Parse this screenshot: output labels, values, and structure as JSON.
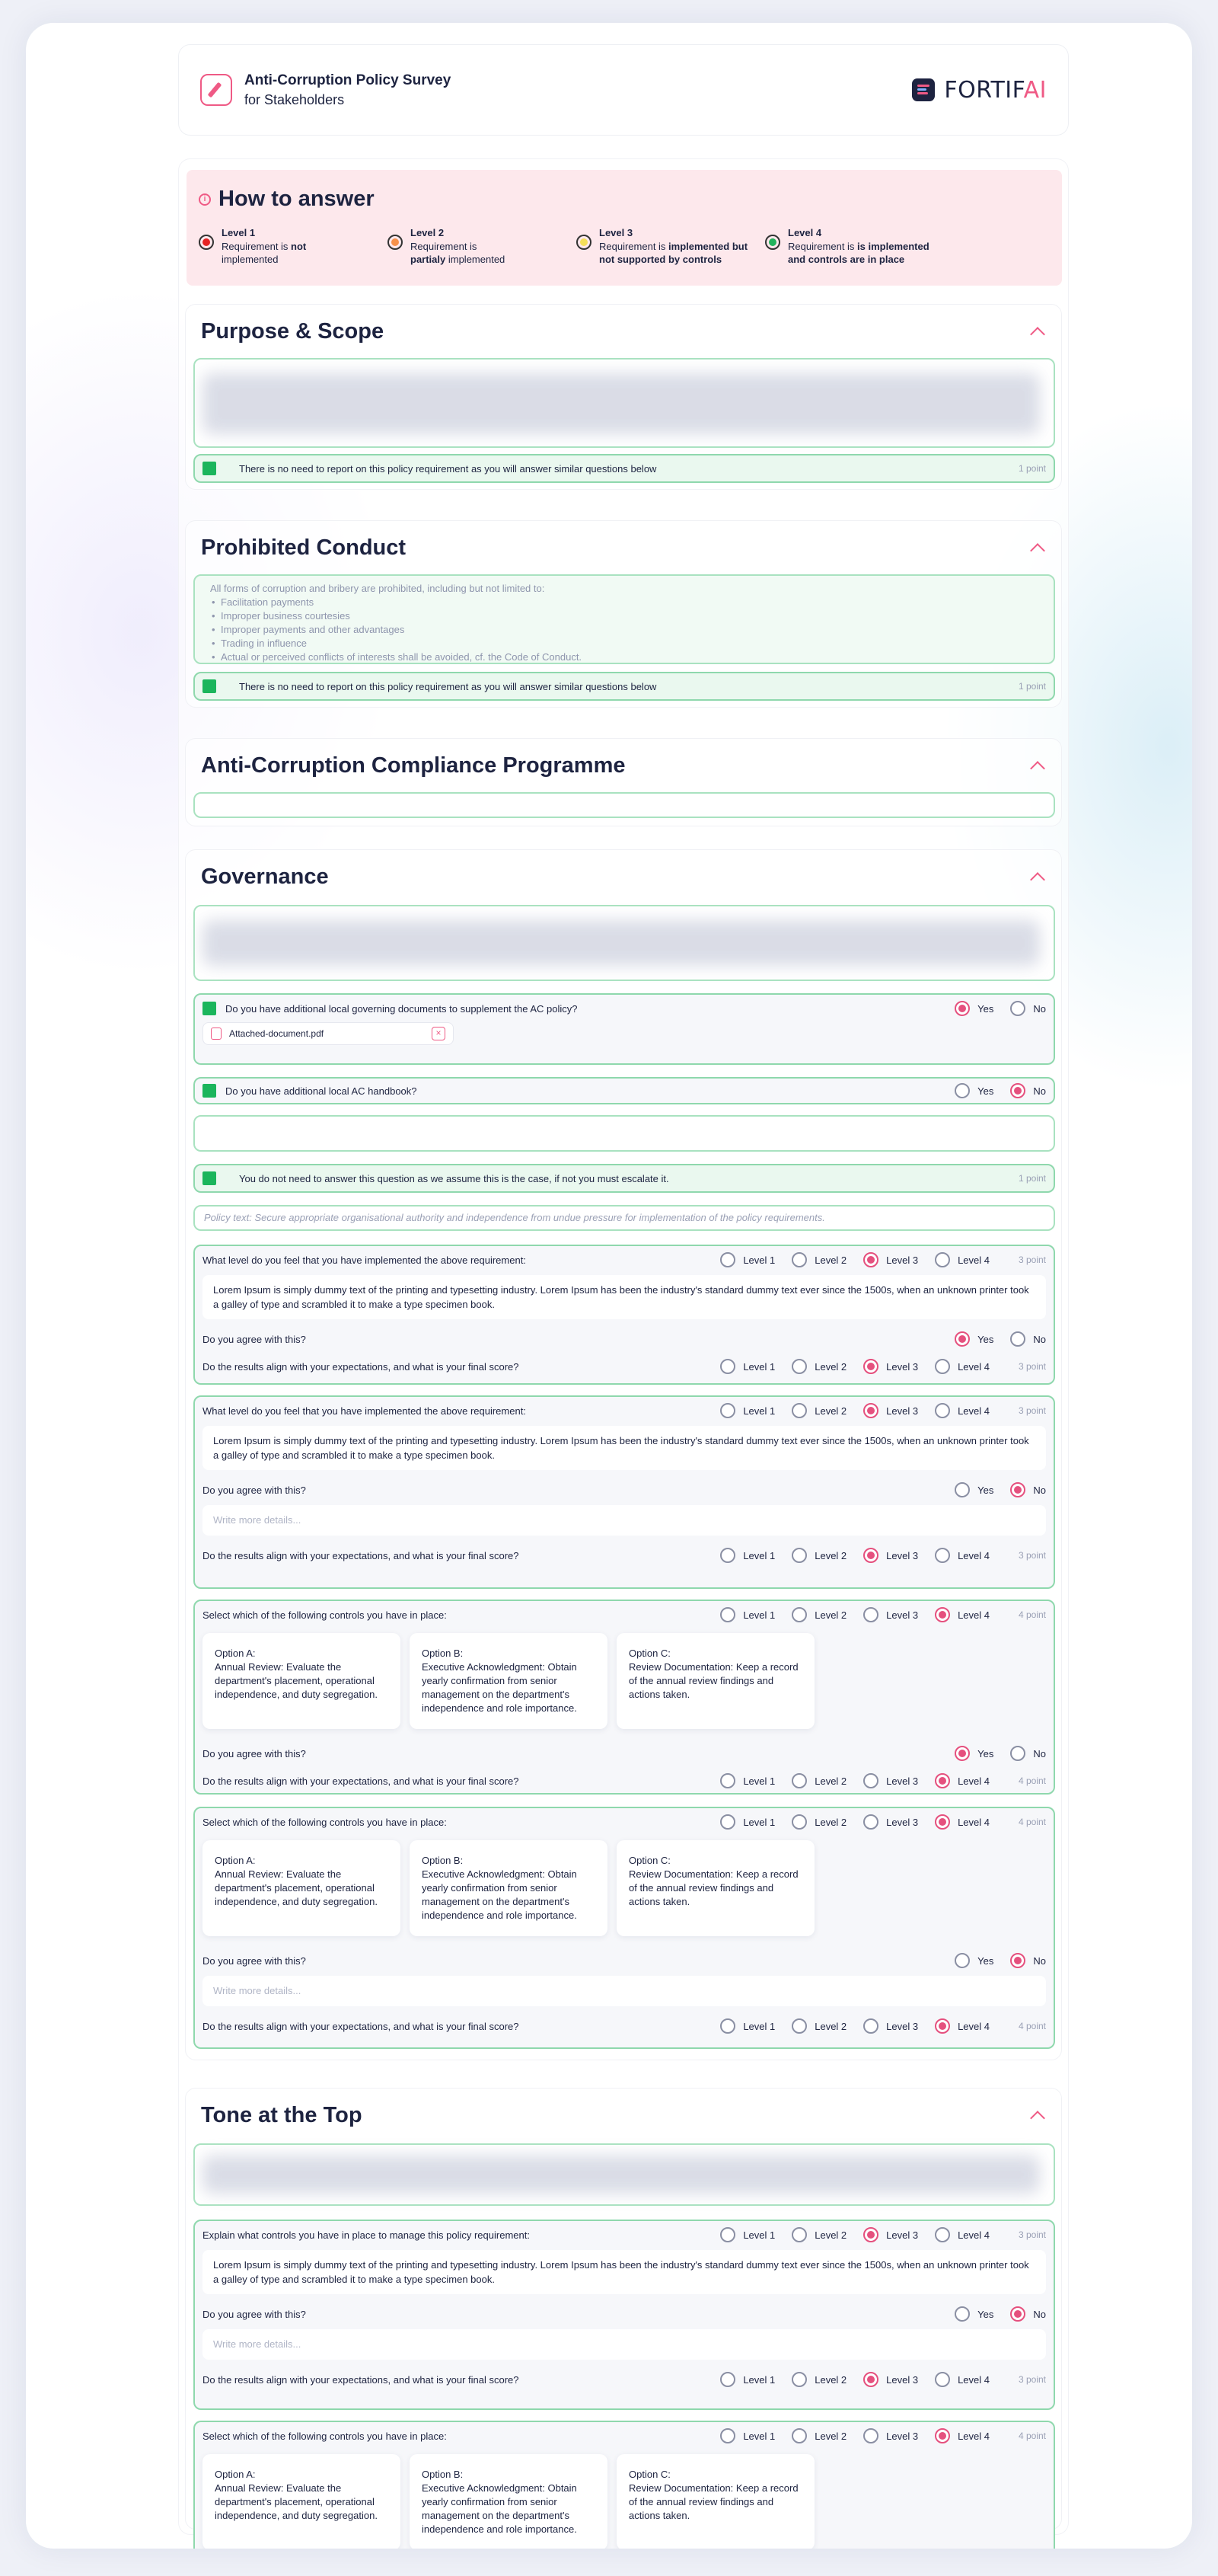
{
  "header": {
    "title": "Anti-Corruption Policy Survey",
    "subtitle": "for Stakeholders",
    "brand_a": "FORTIF",
    "brand_b": "AI"
  },
  "how": {
    "title": "How to answer",
    "levels": [
      {
        "title": "Level 1",
        "color": "#e52424",
        "desc_a": "Requirement is ",
        "desc_b": "not",
        "desc_c": " implemented"
      },
      {
        "title": "Level 2",
        "color": "#f7914b",
        "desc_a": "Requirement is ",
        "desc_b": "partialy",
        "desc_c": " implemented"
      },
      {
        "title": "Level 3",
        "color": "#f5e05a",
        "desc_a": "Requirement is ",
        "desc_b": "implemented but not supported by controls",
        "desc_c": ""
      },
      {
        "title": "Level 4",
        "color": "#22b35c",
        "desc_a": "Requirement is ",
        "desc_b": "is implemented and controls are in place",
        "desc_c": ""
      }
    ]
  },
  "common": {
    "no_report": "There is no need to report on this policy requirement as you will answer similar questions below",
    "one_point": "1 point",
    "three_point": "3 point",
    "four_point": "4 point",
    "level_q": "What level do you feel that you have implemented the above requirement:",
    "agree_q": "Do you agree with this?",
    "results_q": "Do the results align with your expectations, and what is your final score?",
    "controls_q": "Select which of the following controls you have in place:",
    "explain_q": "Explain what controls you have in place to manage this policy requirement:",
    "lorem": "Lorem Ipsum is simply dummy text of the printing and typesetting industry. Lorem Ipsum has been the industry's standard dummy text ever since the 1500s, when an unknown printer took a galley of type and scrambled it to make a type specimen book.",
    "write_more": "Write more details...",
    "yes": "Yes",
    "no": "No",
    "l1": "Level 1",
    "l2": "Level 2",
    "l3": "Level 3",
    "l4": "Level 4",
    "optA_t": "Option A:",
    "optA_d": "Annual Review: Evaluate the department's placement, operational independence, and duty segregation.",
    "optB_t": "Option B:",
    "optB_d": "Executive Acknowledgment: Obtain yearly confirmation from senior management on the department's independence and role importance.",
    "optC_t": "Option C:",
    "optC_d": "Review Documentation: Keep a record of the annual review findings and actions taken."
  },
  "sections": {
    "purpose": "Purpose & Scope",
    "prohibited": "Prohibited Conduct",
    "programme": "Anti-Corruption Compliance Programme",
    "governance": "Governance",
    "tone": "Tone at the Top"
  },
  "prohibited": {
    "intro": "All forms of corruption and bribery are prohibited, including but not limited to:",
    "items": [
      "Facilitation payments",
      "Improper business courtesies",
      "Improper payments and other advantages",
      "Trading in influence",
      "Actual or perceived conflicts of interests shall be avoided, cf. the Code of Conduct."
    ]
  },
  "governance": {
    "q1": "Do you have additional local governing documents to supplement the AC policy?",
    "file": "Attached-document.pdf",
    "q2": "Do you have additional local AC handbook?",
    "escalate": "You do not need to answer this question as we assume this is the case, if not you must escalate it.",
    "policy_text": "Policy text: Secure appropriate organisational authority and independence from undue pressure for implementation of the policy requirements."
  }
}
